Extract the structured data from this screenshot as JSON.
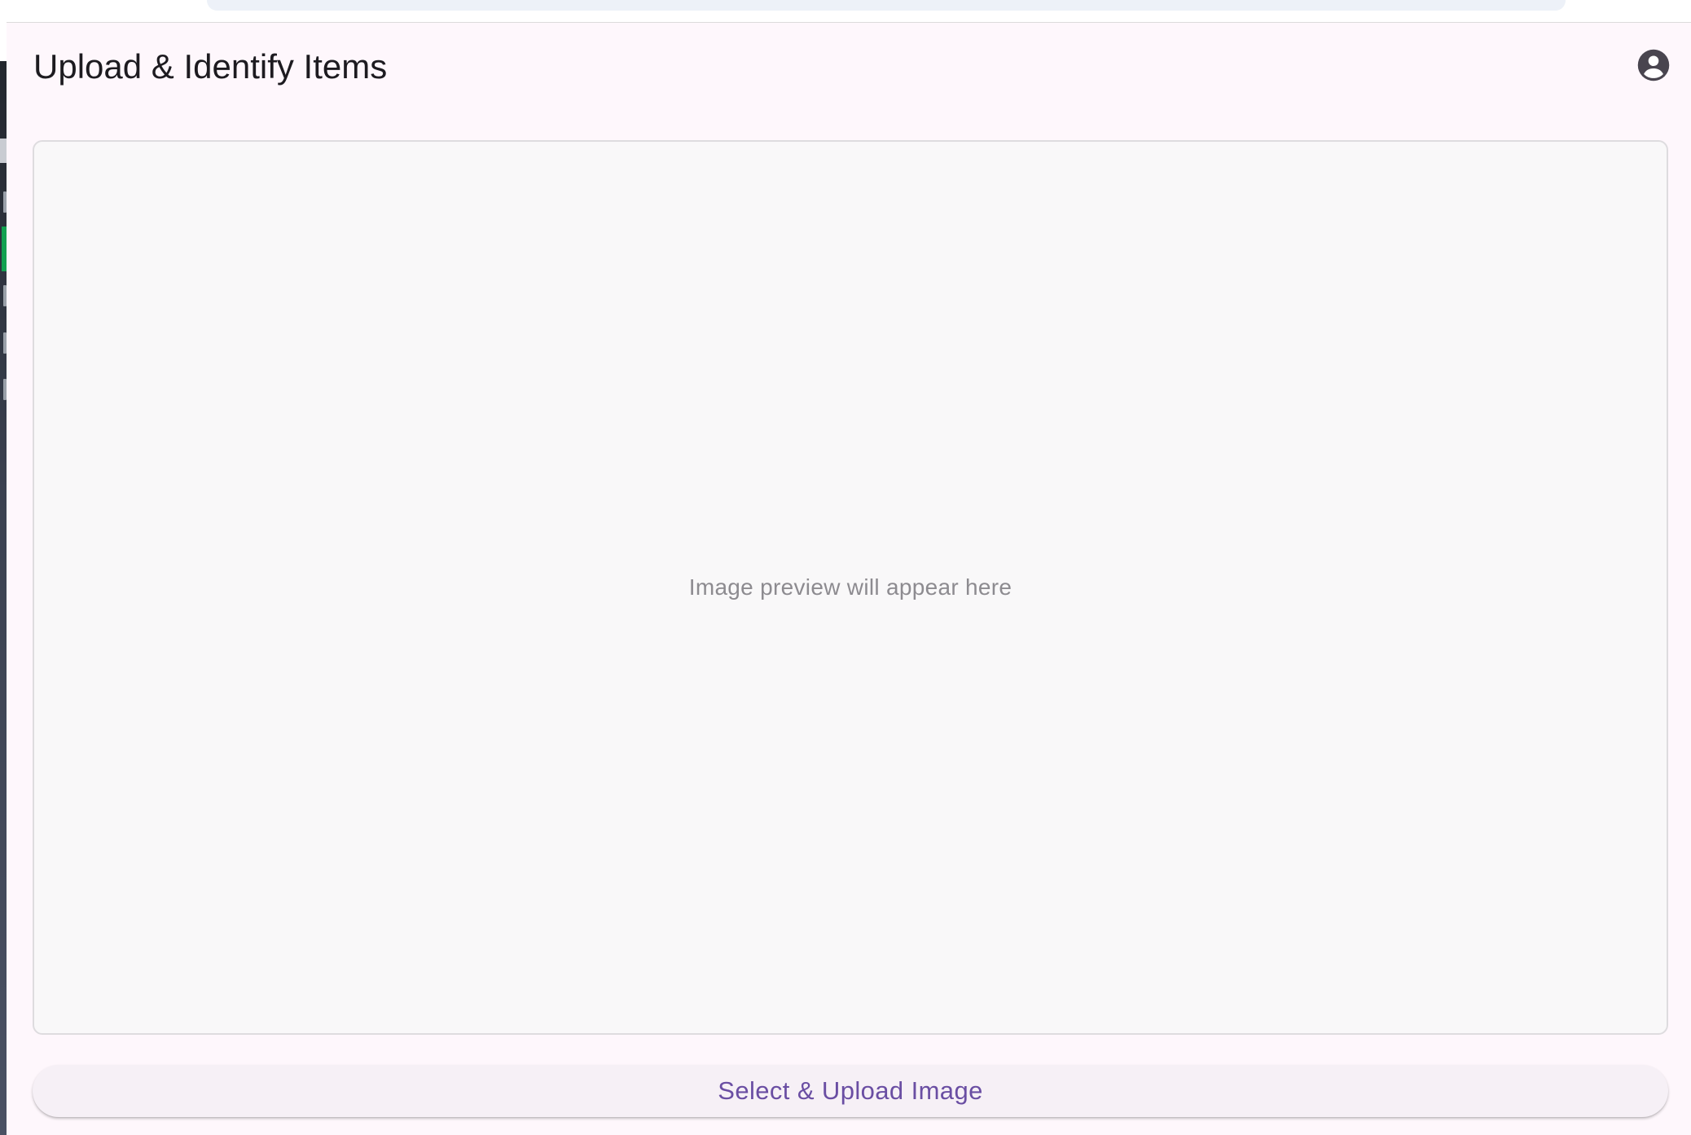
{
  "app": {
    "title": "Upload & Identify Items",
    "account_icon": "account-circle-icon"
  },
  "preview": {
    "placeholder": "Image preview will appear here"
  },
  "actions": {
    "upload_label": "Select & Upload Image"
  },
  "colors": {
    "background": "#fef7fc",
    "preview_background": "#f9f8f9",
    "button_background": "#f6f0f6",
    "accent": "#6a4ea3",
    "title_text": "#1d1b20",
    "placeholder_text": "#8d8b90"
  }
}
